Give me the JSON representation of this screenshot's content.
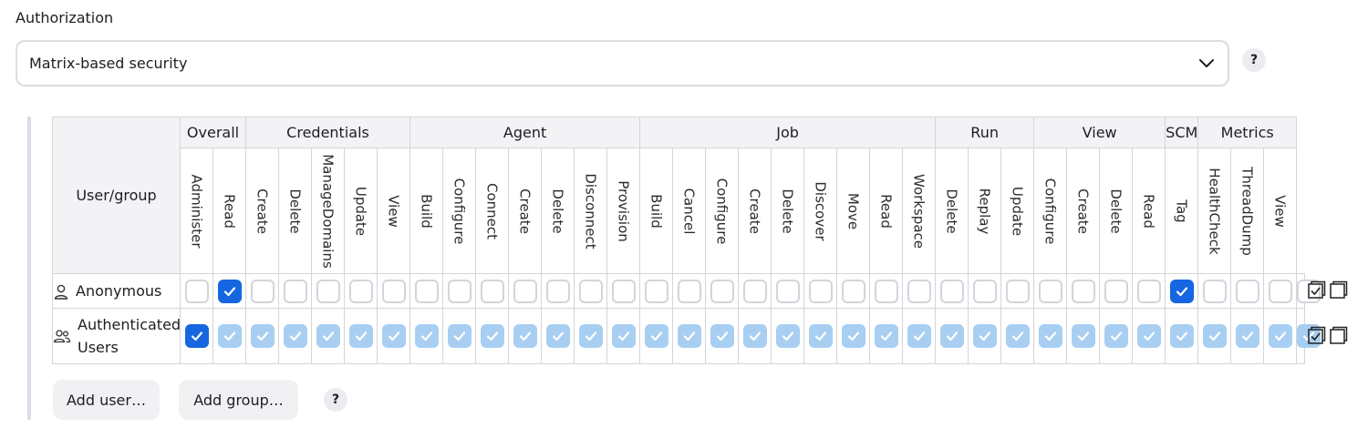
{
  "authorization": {
    "label": "Authorization",
    "selected": "Matrix-based security",
    "help": "?"
  },
  "matrix": {
    "user_group_header": "User/group",
    "groups": [
      {
        "name": "Overall",
        "perms": [
          "Administer",
          "Read"
        ]
      },
      {
        "name": "Credentials",
        "perms": [
          "Create",
          "Delete",
          "ManageDomains",
          "Update",
          "View"
        ]
      },
      {
        "name": "Agent",
        "perms": [
          "Build",
          "Configure",
          "Connect",
          "Create",
          "Delete",
          "Disconnect",
          "Provision"
        ]
      },
      {
        "name": "Job",
        "perms": [
          "Build",
          "Cancel",
          "Configure",
          "Create",
          "Delete",
          "Discover",
          "Move",
          "Read",
          "Workspace"
        ]
      },
      {
        "name": "Run",
        "perms": [
          "Delete",
          "Replay",
          "Update"
        ]
      },
      {
        "name": "View",
        "perms": [
          "Configure",
          "Create",
          "Delete",
          "Read"
        ]
      },
      {
        "name": "SCM",
        "perms": [
          "Tag"
        ]
      },
      {
        "name": "Metrics",
        "perms": [
          "HealthCheck",
          "ThreadDump",
          "View"
        ]
      }
    ],
    "rows": [
      {
        "name": "Anonymous",
        "icon": "user-icon",
        "states": [
          "off",
          "on",
          "off",
          "off",
          "off",
          "off",
          "off",
          "off",
          "off",
          "off",
          "off",
          "off",
          "off",
          "off",
          "off",
          "off",
          "off",
          "off",
          "off",
          "off",
          "off",
          "off",
          "off",
          "off",
          "off",
          "off",
          "off",
          "off",
          "off",
          "off",
          "on",
          "off",
          "off",
          "off",
          "off"
        ]
      },
      {
        "name": "Authenticated Users",
        "icon": "users-icon",
        "states": [
          "on",
          "imp",
          "imp",
          "imp",
          "imp",
          "imp",
          "imp",
          "imp",
          "imp",
          "imp",
          "imp",
          "imp",
          "imp",
          "imp",
          "imp",
          "imp",
          "imp",
          "imp",
          "imp",
          "imp",
          "imp",
          "imp",
          "imp",
          "imp",
          "imp",
          "imp",
          "imp",
          "imp",
          "imp",
          "imp",
          "imp",
          "imp",
          "imp",
          "imp",
          "imp"
        ]
      }
    ]
  },
  "buttons": {
    "add_user": "Add user…",
    "add_group": "Add group…",
    "help": "?"
  },
  "colors": {
    "checked": "#1566e0",
    "implied": "#a8cff2",
    "border": "#d4d4da",
    "header_bg": "#f3f3f6"
  }
}
